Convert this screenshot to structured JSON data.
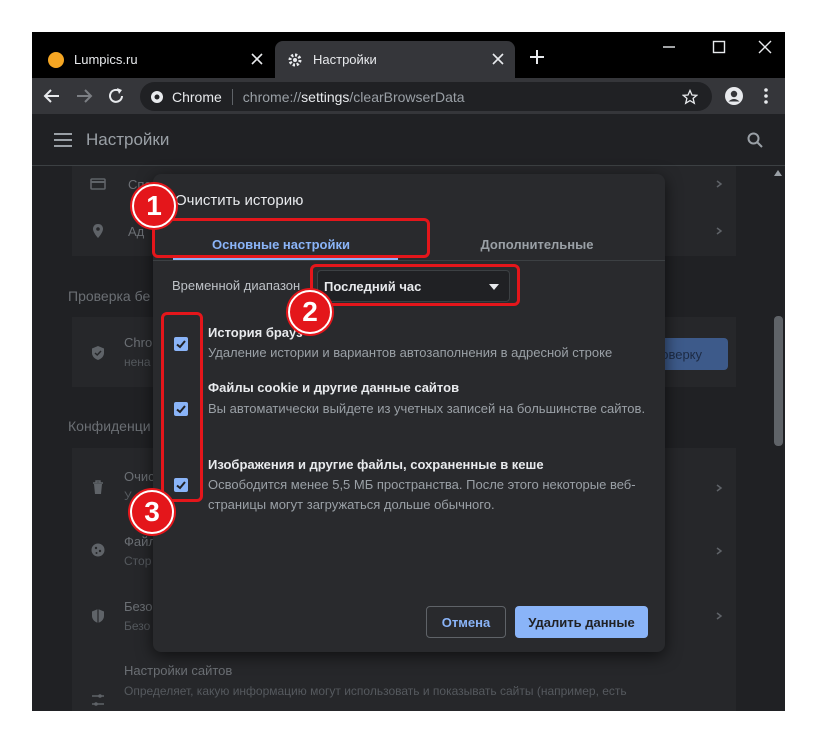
{
  "browser": {
    "tabs": [
      {
        "label": "Lumpics.ru",
        "icon": "lumpics-favicon-icon"
      },
      {
        "label": "Настройки",
        "icon": "gear-icon"
      }
    ],
    "omnibox": {
      "site_name": "Chrome",
      "url_prefix": "chrome://",
      "url_host": "settings",
      "url_path": "/clearBrowserData"
    }
  },
  "settings_page": {
    "header_title": "Настройки",
    "background_items": [
      {
        "text": "Спо"
      },
      {
        "text": "Ад"
      },
      {
        "text": "Проверка бе"
      },
      {
        "text": "Chro"
      },
      {
        "text": "нена"
      },
      {
        "text": "роверку"
      },
      {
        "text": "Конфиденци"
      },
      {
        "text": "Очис"
      },
      {
        "text": "У"
      },
      {
        "text": "Файл"
      },
      {
        "text": "Стор"
      },
      {
        "text": "Безо"
      },
      {
        "text": "Безо"
      },
      {
        "text": "Настройки сайтов"
      },
      {
        "text": "Определяет, какую информацию могут использовать и показывать сайты (например, есть"
      }
    ]
  },
  "dialog": {
    "title": "Очистить историю",
    "tabs": [
      "Основные настройки",
      "Дополнительные"
    ],
    "time_range_label": "Временной диапазон",
    "time_range_value": "Последний час",
    "items": [
      {
        "title": "История брауз",
        "description": "Удаление истории и вариантов автозаполнения в адресной строке",
        "checked": true
      },
      {
        "title": "Файлы cookie и другие данные сайтов",
        "description": "Вы автоматически выйдете из учетных записей на большинстве сайтов.",
        "checked": true
      },
      {
        "title": "Изображения и другие файлы, сохраненные в кеше",
        "description": "Освободится менее 5,5 МБ пространства. После этого некоторые веб-страницы могут загружаться дольше обычного.",
        "checked": true
      }
    ],
    "cancel_label": "Отмена",
    "delete_label": "Удалить данные"
  },
  "annotations": {
    "badges": [
      "1",
      "2",
      "3"
    ],
    "color": "#e4161b"
  },
  "colors": {
    "accent": "#8ab4f8",
    "background": "#202124",
    "dialog": "#292a2d"
  }
}
